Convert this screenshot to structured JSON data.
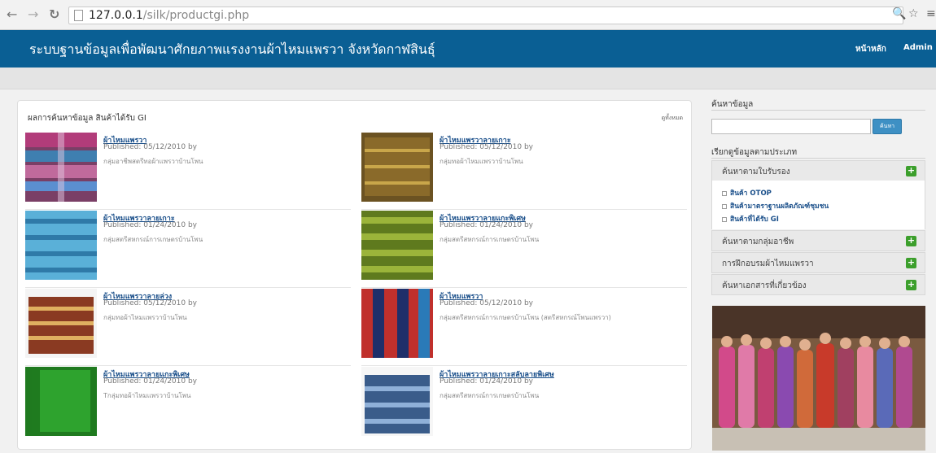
{
  "browser": {
    "url_host": "127.0.0.1",
    "url_path": "/silk/productgi.php"
  },
  "site": {
    "title": "ระบบฐานข้อมูลเพื่อพัฒนาศักยภาพแรงงานผ้าไหมแพรวา จังหวัดกาฬสินธุ์",
    "nav_home": "หน้าหลัก",
    "nav_admin": "Admin",
    "header_color": "#0a5f94"
  },
  "results": {
    "heading": "ผลการค้นหาข้อมูล สินค้าได้รับ GI",
    "view_all": "ดูทั้งหมด",
    "items": [
      {
        "title": "ผ้าไหมแพรวา",
        "published": "Published: 05/12/2010 by",
        "group": "กลุ่มอาชีพสตรีทอผ้าแพรวาบ้านโพน"
      },
      {
        "title": "ผ้าไหมแพรวาลายเกาะ",
        "published": "Published: 05/12/2010 by",
        "group": "กลุ่มทอผ้าไหมแพรวาบ้านโพน"
      },
      {
        "title": "ผ้าไหมแพรวาลายเกาะ",
        "published": "Published: 01/24/2010 by",
        "group": "กลุ่มสตรีสหกรณ์การเกษตรบ้านโพน"
      },
      {
        "title": "ผ้าไหมแพรวาลายแกะพิเศษ",
        "published": "Published: 01/24/2010 by",
        "group": "กลุ่มสตรีสหกรณ์การเกษตรบ้านโพน"
      },
      {
        "title": "ผ้าไหมแพรวาลายล่วง",
        "published": "Published: 05/12/2010 by",
        "group": "กลุ่มทอผ้าไหมแพรวาบ้านโพน"
      },
      {
        "title": "ผ้าไหมแพรวา",
        "published": "Published: 05/12/2010 by",
        "group": "กลุ่มสตรีสหกรณ์การเกษตรบ้านโพน (สตรีสหกรณ์โพนแพรวา)"
      },
      {
        "title": "ผ้าไหมแพรวาลายแกะพิเศษ",
        "published": "Published: 01/24/2010 by",
        "group": "Tกลุ่มทอผ้าไหมแพรวาบ้านโพน"
      },
      {
        "title": "ผ้าไหมแพรวาลายเกาะสลับลายพิเศษ",
        "published": "Published: 01/24/2010 by",
        "group": "กลุ่มสตรีสหกรณ์การเกษตรบ้านโพน"
      }
    ]
  },
  "sidebar": {
    "search_heading": "ค้นหาข้อมูล",
    "search_value": "",
    "search_button": "ค้นหา",
    "browse_heading": "เรียกดูข้อมูลตามประเภท",
    "sections": [
      {
        "label": "ค้นหาตามใบรับรอง",
        "expanded": true
      },
      {
        "label": "ค้นหาตามกลุ่มอาชีพ"
      },
      {
        "label": "การฝึกอบรมผ้าไหมแพรวา"
      },
      {
        "label": "ค้นหาเอกสารที่เกี่ยวข้อง"
      }
    ],
    "cert_items": [
      {
        "label": "สินค้า OTOP"
      },
      {
        "label": "สินค้ามาตราฐานผลิตภัณฑ์ชุมชน"
      },
      {
        "label": "สินค้าที่ได้รับ GI"
      }
    ],
    "accent_green": "#3c9f2c"
  }
}
